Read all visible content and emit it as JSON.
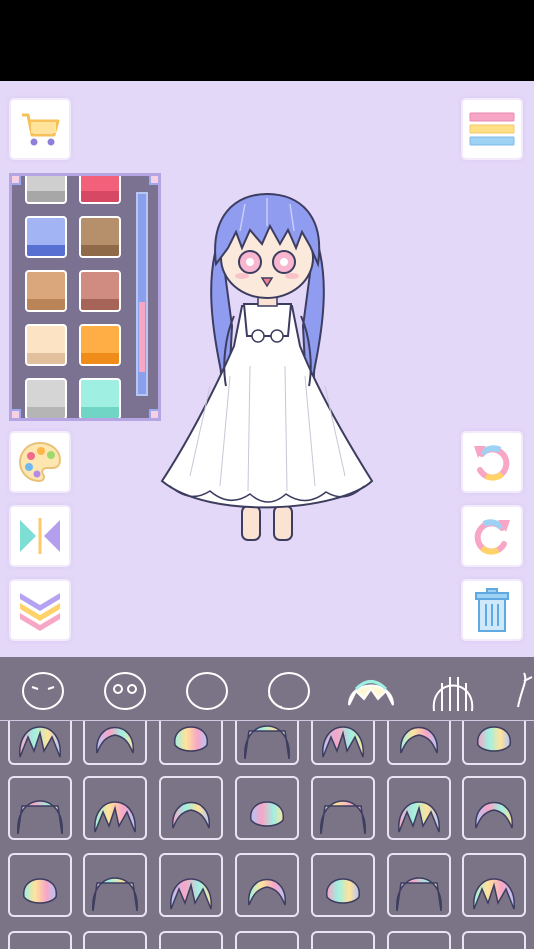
{
  "toolbar": {
    "shop_icon": "cart-icon",
    "menu_icon": "menu-icon",
    "palette_icon": "palette-icon",
    "flip_icon": "flip-icon",
    "hide_icon": "chevron-down-icon",
    "undo_icon": "undo-icon",
    "redo_icon": "redo-icon",
    "delete_icon": "trash-icon"
  },
  "palette": {
    "swatches": [
      {
        "color": "#cfcfcf",
        "shade": "#a7a7a7"
      },
      {
        "color": "#f2607a",
        "shade": "#d64864"
      },
      {
        "color": "#a2b4f4",
        "shade": "#5870d2"
      },
      {
        "color": "#b5906b",
        "shade": "#8e6a48"
      },
      {
        "color": "#d9a77b",
        "shade": "#b88458"
      },
      {
        "color": "#d08c80",
        "shade": "#a66459"
      },
      {
        "color": "#fbe3c3",
        "shade": "#e2bf9d"
      },
      {
        "color": "#ffae45",
        "shade": "#f08d1a"
      },
      {
        "color": "#d5d5d5",
        "shade": "#b5b5b5"
      },
      {
        "color": "#9ff0e2",
        "shade": "#70d5c4"
      }
    ]
  },
  "tabs": [
    "face-shape-icon",
    "eyes-icon",
    "head-icon",
    "head-alt-icon",
    "bangs-icon",
    "hair-icon",
    "accessory-icon"
  ],
  "active_tab": 4,
  "hair_items_count": 24
}
